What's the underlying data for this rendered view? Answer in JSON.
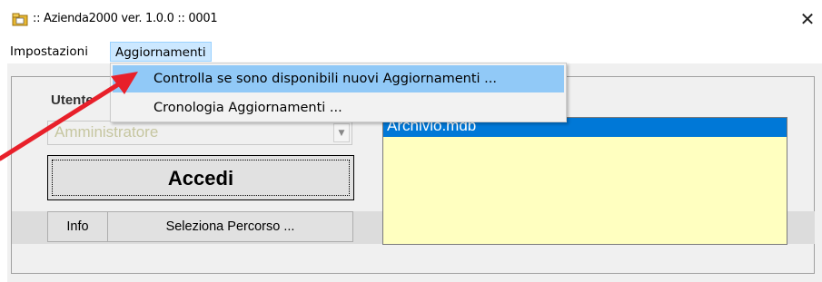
{
  "window": {
    "title": ":: Azienda2000  ver. 1.0.0 :: 0001",
    "close_glyph": "✕",
    "icon": "folder-app-icon"
  },
  "menubar": {
    "items": [
      {
        "label": "Impostazioni",
        "active": false
      },
      {
        "label": "Aggiornamenti",
        "active": true
      }
    ]
  },
  "dropdown": {
    "items": [
      {
        "label": "Controlla se sono disponibili nuovi Aggiornamenti ...",
        "highlighted": true
      },
      {
        "label": "Cronologia Aggiornamenti ...",
        "highlighted": false
      }
    ]
  },
  "login": {
    "user_label": "Utente",
    "user_value": "Amministratore",
    "combo_arrow": "▼",
    "login_button": "Accedi"
  },
  "buttons": {
    "info": "Info",
    "select_path": "Seleziona Percorso ..."
  },
  "archive_list": {
    "items": [
      "Archivio.mdb"
    ],
    "selected_index": 0
  },
  "colors": {
    "menu_active_bg": "#cce8ff",
    "dropdown_highlight": "#91c9f7",
    "list_bg": "#ffffc0",
    "list_selection": "#0078d7",
    "annotation_arrow": "#e8202a"
  }
}
